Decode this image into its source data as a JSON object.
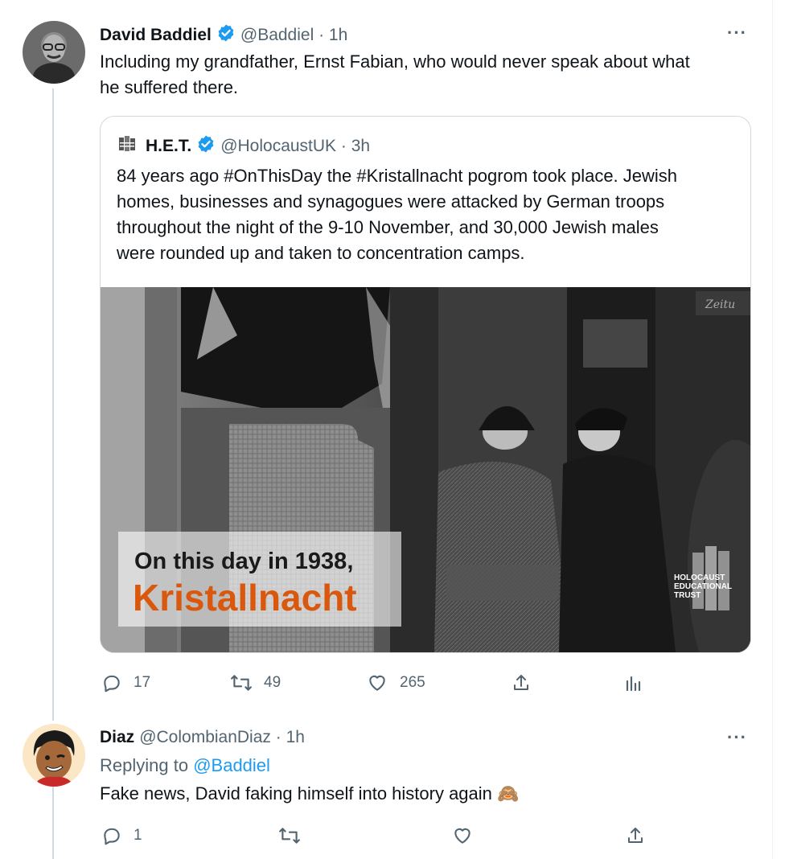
{
  "tweet_main": {
    "name": "David Baddiel",
    "handle": "@Baddiel",
    "time": "1h",
    "more": "···",
    "text_line1": "Including my grandfather, Ernst Fabian, who would never speak about what",
    "text_line2": "he suffered there."
  },
  "quote": {
    "name": "H.E.T.",
    "handle": "@HolocaustUK",
    "time": "3h",
    "text_lines": [
      "84 years ago #OnThisDay the #Kristallnacht pogrom took place. Jewish",
      "homes, businesses and synagogues were attacked by German troops",
      "throughout the night of the 9-10 November, and 30,000 Jewish males",
      "were rounded up and taken to concentration camps."
    ],
    "image": {
      "caption_line1": "On this day in 1938,",
      "caption_line2": "Kristallnacht",
      "logo_line1": "HOLOCAUST",
      "logo_line2": "EDUCATIONAL",
      "logo_line3": "TRUST",
      "sign_text": "Zeitu"
    }
  },
  "actions_main": {
    "reply_count": "17",
    "retweet_count": "49",
    "like_count": "265"
  },
  "tweet_reply": {
    "name": "Diaz",
    "handle": "@ColombianDiaz",
    "time": "1h",
    "more": "···",
    "replying_prefix": "Replying to",
    "replying_to": "@Baddiel",
    "text": "Fake news, David faking himself into history again",
    "emoji": "🙈"
  },
  "actions_reply": {
    "reply_count": "1"
  },
  "colors": {
    "verified": "#1d9bf0",
    "link": "#1d9bf0",
    "secondary": "#536471",
    "accent_orange": "#d9580d"
  }
}
